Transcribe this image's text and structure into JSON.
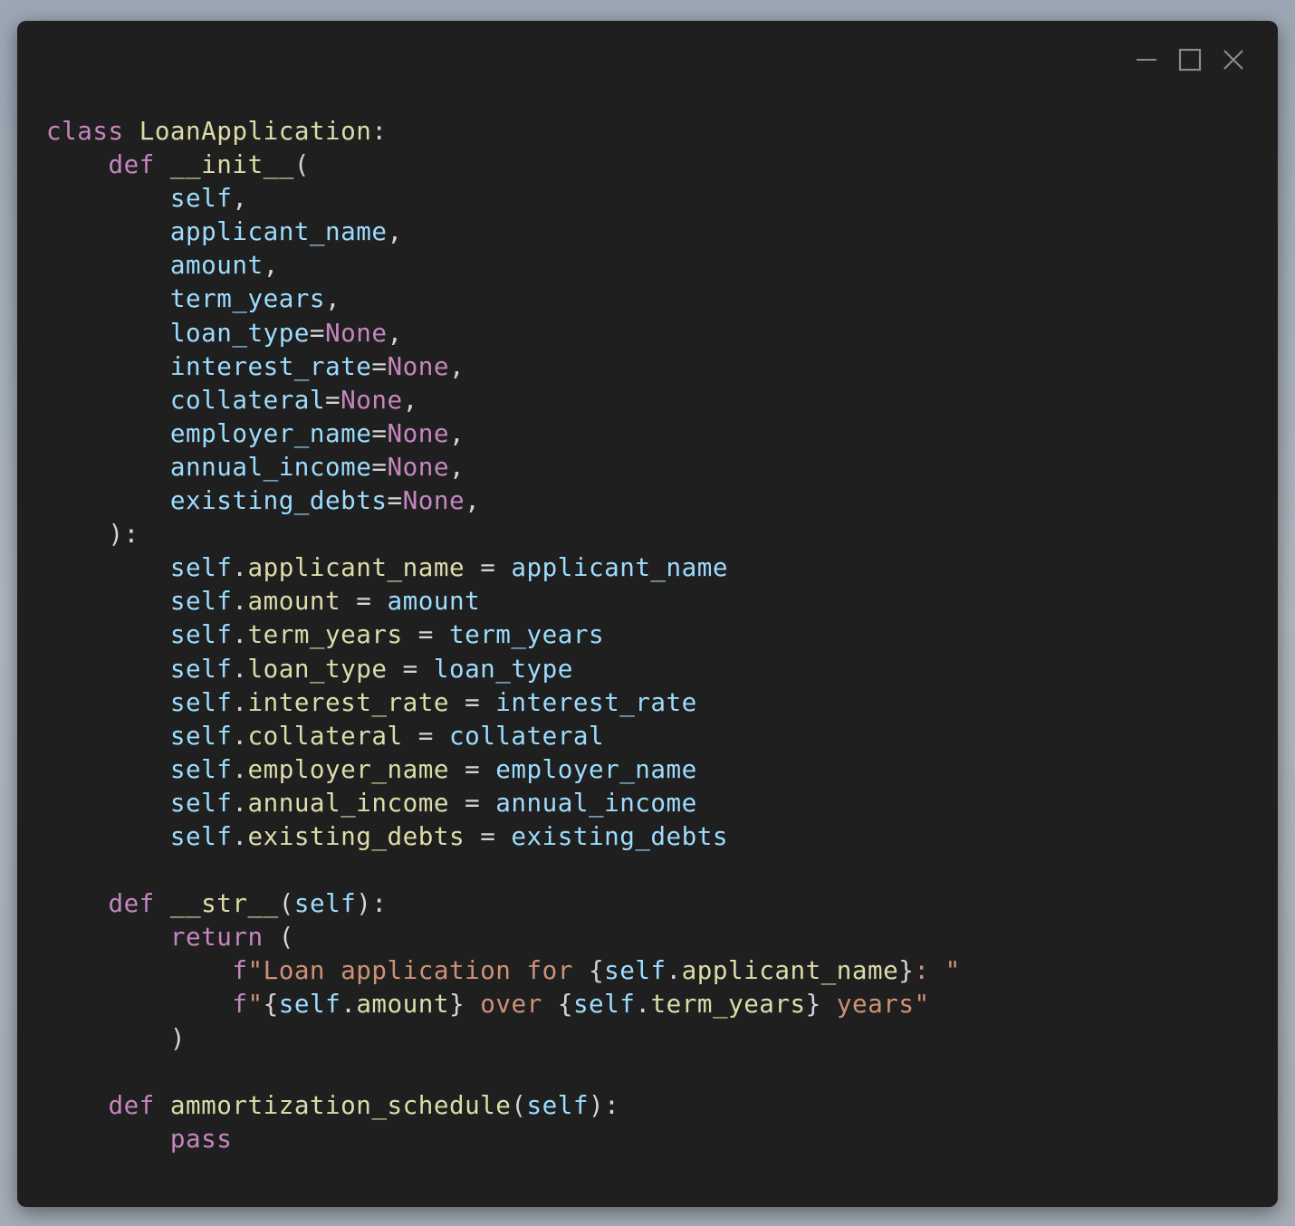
{
  "window": {
    "controls": {
      "minimize": "minimize-icon",
      "maximize": "maximize-icon",
      "close": "close-icon"
    }
  },
  "colors": {
    "background": "#1f1f1f",
    "keyword": "#c586c0",
    "function": "#dcdcaa",
    "variable": "#9cdcfe",
    "string": "#ce9178",
    "text": "#d4d4d4"
  },
  "code": {
    "lines": [
      [
        [
          "kw",
          "class"
        ],
        [
          "op",
          " "
        ],
        [
          "cls",
          "LoanApplication"
        ],
        [
          "op",
          ":"
        ]
      ],
      [
        [
          "op",
          "    "
        ],
        [
          "kw",
          "def"
        ],
        [
          "op",
          " "
        ],
        [
          "fn",
          "__init__"
        ],
        [
          "op",
          "("
        ]
      ],
      [
        [
          "op",
          "        "
        ],
        [
          "var",
          "self"
        ],
        [
          "op",
          ","
        ]
      ],
      [
        [
          "op",
          "        "
        ],
        [
          "var",
          "applicant_name"
        ],
        [
          "op",
          ","
        ]
      ],
      [
        [
          "op",
          "        "
        ],
        [
          "var",
          "amount"
        ],
        [
          "op",
          ","
        ]
      ],
      [
        [
          "op",
          "        "
        ],
        [
          "var",
          "term_years"
        ],
        [
          "op",
          ","
        ]
      ],
      [
        [
          "op",
          "        "
        ],
        [
          "var",
          "loan_type"
        ],
        [
          "op",
          "="
        ],
        [
          "kw",
          "None"
        ],
        [
          "op",
          ","
        ]
      ],
      [
        [
          "op",
          "        "
        ],
        [
          "var",
          "interest_rate"
        ],
        [
          "op",
          "="
        ],
        [
          "kw",
          "None"
        ],
        [
          "op",
          ","
        ]
      ],
      [
        [
          "op",
          "        "
        ],
        [
          "var",
          "collateral"
        ],
        [
          "op",
          "="
        ],
        [
          "kw",
          "None"
        ],
        [
          "op",
          ","
        ]
      ],
      [
        [
          "op",
          "        "
        ],
        [
          "var",
          "employer_name"
        ],
        [
          "op",
          "="
        ],
        [
          "kw",
          "None"
        ],
        [
          "op",
          ","
        ]
      ],
      [
        [
          "op",
          "        "
        ],
        [
          "var",
          "annual_income"
        ],
        [
          "op",
          "="
        ],
        [
          "kw",
          "None"
        ],
        [
          "op",
          ","
        ]
      ],
      [
        [
          "op",
          "        "
        ],
        [
          "var",
          "existing_debts"
        ],
        [
          "op",
          "="
        ],
        [
          "kw",
          "None"
        ],
        [
          "op",
          ","
        ]
      ],
      [
        [
          "op",
          "    ):"
        ]
      ],
      [
        [
          "op",
          "        "
        ],
        [
          "var",
          "self"
        ],
        [
          "op",
          "."
        ],
        [
          "attr",
          "applicant_name"
        ],
        [
          "op",
          " = "
        ],
        [
          "var",
          "applicant_name"
        ]
      ],
      [
        [
          "op",
          "        "
        ],
        [
          "var",
          "self"
        ],
        [
          "op",
          "."
        ],
        [
          "attr",
          "amount"
        ],
        [
          "op",
          " = "
        ],
        [
          "var",
          "amount"
        ]
      ],
      [
        [
          "op",
          "        "
        ],
        [
          "var",
          "self"
        ],
        [
          "op",
          "."
        ],
        [
          "attr",
          "term_years"
        ],
        [
          "op",
          " = "
        ],
        [
          "var",
          "term_years"
        ]
      ],
      [
        [
          "op",
          "        "
        ],
        [
          "var",
          "self"
        ],
        [
          "op",
          "."
        ],
        [
          "attr",
          "loan_type"
        ],
        [
          "op",
          " = "
        ],
        [
          "var",
          "loan_type"
        ]
      ],
      [
        [
          "op",
          "        "
        ],
        [
          "var",
          "self"
        ],
        [
          "op",
          "."
        ],
        [
          "attr",
          "interest_rate"
        ],
        [
          "op",
          " = "
        ],
        [
          "var",
          "interest_rate"
        ]
      ],
      [
        [
          "op",
          "        "
        ],
        [
          "var",
          "self"
        ],
        [
          "op",
          "."
        ],
        [
          "attr",
          "collateral"
        ],
        [
          "op",
          " = "
        ],
        [
          "var",
          "collateral"
        ]
      ],
      [
        [
          "op",
          "        "
        ],
        [
          "var",
          "self"
        ],
        [
          "op",
          "."
        ],
        [
          "attr",
          "employer_name"
        ],
        [
          "op",
          " = "
        ],
        [
          "var",
          "employer_name"
        ]
      ],
      [
        [
          "op",
          "        "
        ],
        [
          "var",
          "self"
        ],
        [
          "op",
          "."
        ],
        [
          "attr",
          "annual_income"
        ],
        [
          "op",
          " = "
        ],
        [
          "var",
          "annual_income"
        ]
      ],
      [
        [
          "op",
          "        "
        ],
        [
          "var",
          "self"
        ],
        [
          "op",
          "."
        ],
        [
          "attr",
          "existing_debts"
        ],
        [
          "op",
          " = "
        ],
        [
          "var",
          "existing_debts"
        ]
      ],
      [
        [
          "op",
          " "
        ]
      ],
      [
        [
          "op",
          "    "
        ],
        [
          "kw",
          "def"
        ],
        [
          "op",
          " "
        ],
        [
          "fn",
          "__str__"
        ],
        [
          "op",
          "("
        ],
        [
          "var",
          "self"
        ],
        [
          "op",
          "):"
        ]
      ],
      [
        [
          "op",
          "        "
        ],
        [
          "kw",
          "return"
        ],
        [
          "op",
          " ("
        ]
      ],
      [
        [
          "op",
          "            "
        ],
        [
          "kw",
          "f"
        ],
        [
          "str",
          "\"Loan application for "
        ],
        [
          "brace",
          "{"
        ],
        [
          "var",
          "self"
        ],
        [
          "op",
          "."
        ],
        [
          "attr",
          "applicant_name"
        ],
        [
          "brace",
          "}"
        ],
        [
          "str",
          ": \""
        ]
      ],
      [
        [
          "op",
          "            "
        ],
        [
          "kw",
          "f"
        ],
        [
          "str",
          "\""
        ],
        [
          "brace",
          "{"
        ],
        [
          "var",
          "self"
        ],
        [
          "op",
          "."
        ],
        [
          "attr",
          "amount"
        ],
        [
          "brace",
          "}"
        ],
        [
          "str",
          " over "
        ],
        [
          "brace",
          "{"
        ],
        [
          "var",
          "self"
        ],
        [
          "op",
          "."
        ],
        [
          "attr",
          "term_years"
        ],
        [
          "brace",
          "}"
        ],
        [
          "str",
          " years\""
        ]
      ],
      [
        [
          "op",
          "        )"
        ]
      ],
      [
        [
          "op",
          " "
        ]
      ],
      [
        [
          "op",
          "    "
        ],
        [
          "kw",
          "def"
        ],
        [
          "op",
          " "
        ],
        [
          "fn",
          "ammortization_schedule"
        ],
        [
          "op",
          "("
        ],
        [
          "var",
          "self"
        ],
        [
          "op",
          "):"
        ]
      ],
      [
        [
          "op",
          "        "
        ],
        [
          "kw",
          "pass"
        ]
      ]
    ]
  }
}
